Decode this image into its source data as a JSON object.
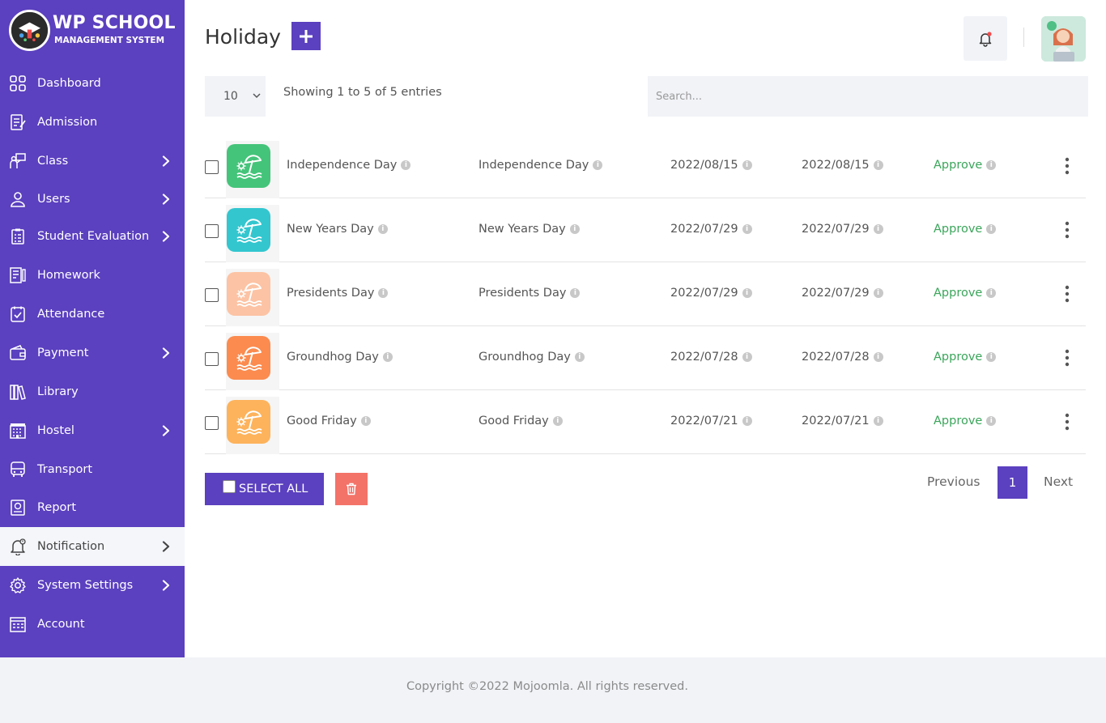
{
  "brand": {
    "title": "WP SCHOOL",
    "subtitle": "MANAGEMENT SYSTEM"
  },
  "sidebar": {
    "items": [
      {
        "label": "Dashboard",
        "icon": "dashboard-grid-icon",
        "has_submenu": false,
        "active": false
      },
      {
        "label": "Admission",
        "icon": "admission-form-icon",
        "has_submenu": false,
        "active": false
      },
      {
        "label": "Class",
        "icon": "class-teacher-icon",
        "has_submenu": true,
        "active": false
      },
      {
        "label": "Users",
        "icon": "user-icon",
        "has_submenu": true,
        "active": false
      },
      {
        "label": "Student Evaluation",
        "icon": "evaluation-clipboard-icon",
        "has_submenu": true,
        "active": false
      },
      {
        "label": "Homework",
        "icon": "homework-book-icon",
        "has_submenu": false,
        "active": false
      },
      {
        "label": "Attendance",
        "icon": "attendance-check-icon",
        "has_submenu": false,
        "active": false
      },
      {
        "label": "Payment",
        "icon": "wallet-icon",
        "has_submenu": true,
        "active": false
      },
      {
        "label": "Library",
        "icon": "library-books-icon",
        "has_submenu": false,
        "active": false
      },
      {
        "label": "Hostel",
        "icon": "hostel-building-icon",
        "has_submenu": true,
        "active": false
      },
      {
        "label": "Transport",
        "icon": "bus-icon",
        "has_submenu": false,
        "active": false
      },
      {
        "label": "Report",
        "icon": "report-icon",
        "has_submenu": false,
        "active": false
      },
      {
        "label": "Notification",
        "icon": "notification-bell-icon",
        "has_submenu": true,
        "active": true
      },
      {
        "label": "System Settings",
        "icon": "gear-icon",
        "has_submenu": true,
        "active": false
      },
      {
        "label": "Account",
        "icon": "account-icon",
        "has_submenu": false,
        "active": false
      }
    ]
  },
  "header": {
    "title": "Holiday",
    "add_icon": "plus-icon",
    "bell_icon": "bell-icon"
  },
  "table_controls": {
    "page_size": "10",
    "entries_info": "Showing 1 to 5 of 5 entries",
    "search_placeholder": "Search..."
  },
  "rows": [
    {
      "name": "Independence Day",
      "description": "Independence Day",
      "start_date": "2022/08/15",
      "end_date": "2022/08/15",
      "status": "Approve",
      "color": "#44c47a"
    },
    {
      "name": "New Years Day",
      "description": "New Years Day",
      "start_date": "2022/07/29",
      "end_date": "2022/07/29",
      "status": "Approve",
      "color": "#33c6cf"
    },
    {
      "name": "Presidents Day",
      "description": "Presidents Day",
      "start_date": "2022/07/29",
      "end_date": "2022/07/29",
      "status": "Approve",
      "color": "#fcc3a4"
    },
    {
      "name": "Groundhog Day",
      "description": "Groundhog Day",
      "start_date": "2022/07/28",
      "end_date": "2022/07/28",
      "status": "Approve",
      "color": "#fb8b4f"
    },
    {
      "name": "Good Friday",
      "description": "Good Friday",
      "start_date": "2022/07/21",
      "end_date": "2022/07/21",
      "status": "Approve",
      "color": "#fdb35c"
    }
  ],
  "bulk_actions": {
    "select_all_label": "SELECT ALL",
    "delete_icon": "trash-icon"
  },
  "pagination": {
    "previous": "Previous",
    "current": "1",
    "next": "Next"
  },
  "footer": {
    "text": "Copyright ©2022 Mojoomla. All rights reserved."
  },
  "colors": {
    "primary": "#5b40bf",
    "approve": "#3aa55a",
    "delete": "#f37369"
  }
}
